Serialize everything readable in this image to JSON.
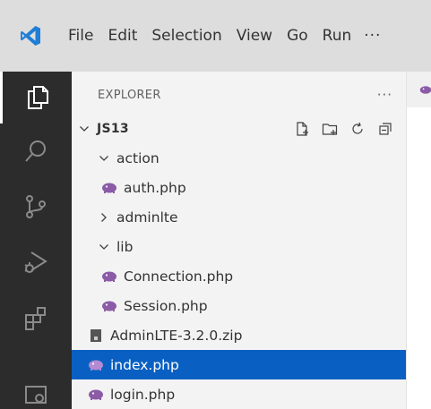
{
  "menu": {
    "items": [
      "File",
      "Edit",
      "Selection",
      "View",
      "Go",
      "Run"
    ],
    "more": "···"
  },
  "activity_bar": {
    "icons": [
      "explorer-icon",
      "search-icon",
      "source-control-icon",
      "run-debug-icon",
      "extensions-icon",
      "remote-explorer-icon"
    ]
  },
  "sidebar": {
    "title": "EXPLORER",
    "more": "···",
    "root": {
      "name": "JS13",
      "actions": [
        "new-file-icon",
        "new-folder-icon",
        "refresh-icon",
        "collapse-all-icon"
      ]
    },
    "tree": [
      {
        "label": "action",
        "type": "folder",
        "expanded": true,
        "depth": 1
      },
      {
        "label": "auth.php",
        "type": "php",
        "depth": 2
      },
      {
        "label": "adminlte",
        "type": "folder",
        "expanded": false,
        "depth": 1
      },
      {
        "label": "lib",
        "type": "folder",
        "expanded": true,
        "depth": 1
      },
      {
        "label": "Connection.php",
        "type": "php",
        "depth": 2
      },
      {
        "label": "Session.php",
        "type": "php",
        "depth": 2
      },
      {
        "label": "AdminLTE-3.2.0.zip",
        "type": "zip",
        "depth": 1
      },
      {
        "label": "index.php",
        "type": "php",
        "depth": 1,
        "selected": true
      },
      {
        "label": "login.php",
        "type": "php",
        "depth": 1
      }
    ]
  },
  "colors": {
    "accent": "#0a60c2",
    "php_icon": "#8b5ba7",
    "vscode_blue": "#1f7ed6"
  }
}
